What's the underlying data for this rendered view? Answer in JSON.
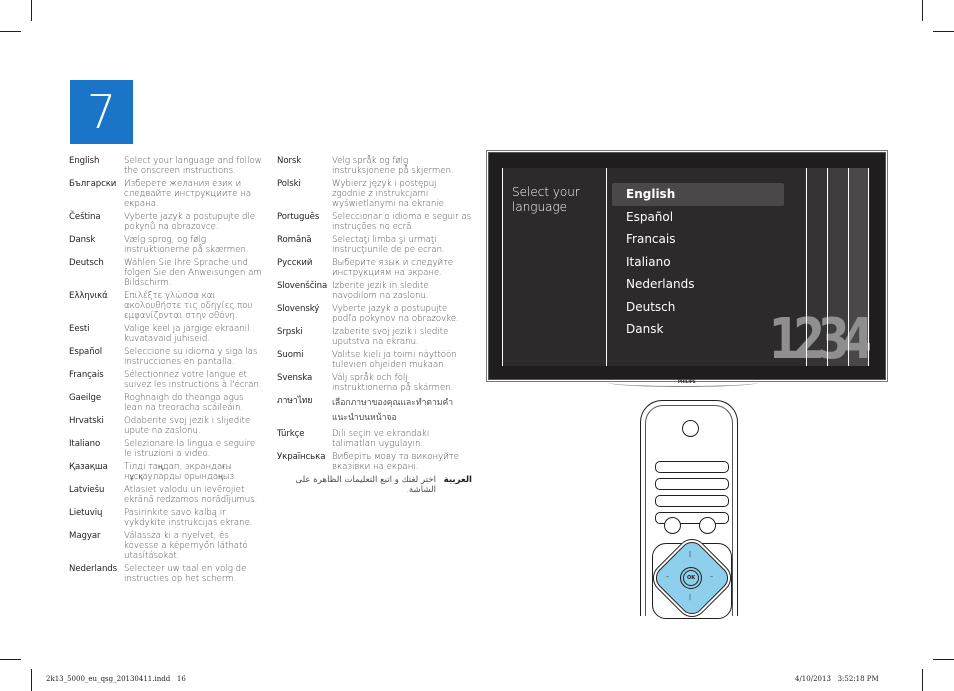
{
  "step": {
    "number": "7",
    "color": "#1a75c8"
  },
  "languages_col1": [
    {
      "name": "English",
      "text": "Select your language and follow the onscreen instructions."
    },
    {
      "name": "Български",
      "text": "Изберете желания език и следвайте инструкциите на екрана."
    },
    {
      "name": "Čeština",
      "text": "Vyberte jazyk a postupujte dle pokynů na obrazovce."
    },
    {
      "name": "Dansk",
      "text": "Vælg sprog, og følg instruktionerne på skærmen."
    },
    {
      "name": "Deutsch",
      "text": "Wählen Sie Ihre Sprache und folgen Sie den Anweisungen am Bildschirm."
    },
    {
      "name": "Ελληνικά",
      "text": "Επιλέξτε γλώσσα και ακολουθήστε τις οδηγίες που εμφανίζονται στην οθόνη."
    },
    {
      "name": "Eesti",
      "text": "Valige keel ja järgige ekraanil kuvatavaid juhiseid."
    },
    {
      "name": "Español",
      "text": "Seleccione su idioma y siga las instrucciones en pantalla."
    },
    {
      "name": "Français",
      "text": "Sélectionnez votre langue et suivez les instructions à l'écran."
    },
    {
      "name": "Gaeilge",
      "text": "Roghnaigh do theanga agus lean na treoracha scáileáin."
    },
    {
      "name": "Hrvatski",
      "text": "Odaberite svoj jezik i slijedite upute na zaslonu."
    },
    {
      "name": "Italiano",
      "text": "Selezionare la lingua e seguire le istruzioni a video."
    },
    {
      "name": "Қазақша",
      "text": "Тілді таңдап, экрандағы нұсқауларды орындаңыз."
    },
    {
      "name": "Latviešu",
      "text": "Atlasiet valodu un ievērojiet ekrānā redzamos norādījumus."
    },
    {
      "name": "Lietuvių",
      "text": "Pasirinkite savo kalbą ir vykdykite instrukcijas ekrane."
    },
    {
      "name": "Magyar",
      "text": "Válassza ki a nyelvet, és kövesse a képernyőn látható utasításokat."
    },
    {
      "name": "Nederlands",
      "text": "Selecteer uw taal en volg de instructies op het scherm."
    }
  ],
  "languages_col2": [
    {
      "name": "Norsk",
      "text": "Velg språk og følg instruksjonene på skjermen."
    },
    {
      "name": "Polski",
      "text": "Wybierz język i postępuj zgodnie z instrukcjami wyświetlanymi na ekranie."
    },
    {
      "name": "Português",
      "text": "Seleccionar o idioma e seguir as instruções no ecrã."
    },
    {
      "name": "Română",
      "text": "Selectaţi limba şi urmaţi instrucţiunile de pe ecran."
    },
    {
      "name": "Русский",
      "text": "Выберите язык и следуйте инструкциям на экране."
    },
    {
      "name": "Slovenščina",
      "text": "Izberite jezik in sledite navodilom na zaslonu."
    },
    {
      "name": "Slovenský",
      "text": "Vyberte jazyk a postupujte podľa pokynov na obrazovke."
    },
    {
      "name": "Srpski",
      "text": "Izaberite svoj jezik i sledite uputstva na ekranu."
    },
    {
      "name": "Suomi",
      "text": "Valitse kieli ja toimi näyttöön tulevien ohjeiden mukaan."
    },
    {
      "name": "Svenska",
      "text": "Välj språk och följ instruktionerna på skärmen."
    },
    {
      "name": "ภาษาไทย",
      "text": "เลือกภาษาของคุณและทำตามคำแนะนำบนหน้าจอ"
    },
    {
      "name": "Türkçe",
      "text": "Dili seçin ve ekrandaki talimatları uygulayın."
    },
    {
      "name": "Українська",
      "text": "Виберіть мову та виконуйте вказівки на екрані."
    },
    {
      "name": "العربية",
      "text": "اختر لغتك و اتبع التعليمات الظاهرة على الشاشة."
    }
  ],
  "tv": {
    "heading": "Select your language",
    "menu": [
      "English",
      "Español",
      "Francais",
      "Italiano",
      "Nederlands",
      "Deutsch",
      "Dansk"
    ],
    "selected_index": 0,
    "big_number": "1234",
    "brand": "PHILIPS"
  },
  "remote": {
    "ok_label": "OK"
  },
  "footer": {
    "left": "2k13_5000_eu_qsg_20130411.indd   16",
    "right": "4/10/2013   3:52:18 PM"
  }
}
